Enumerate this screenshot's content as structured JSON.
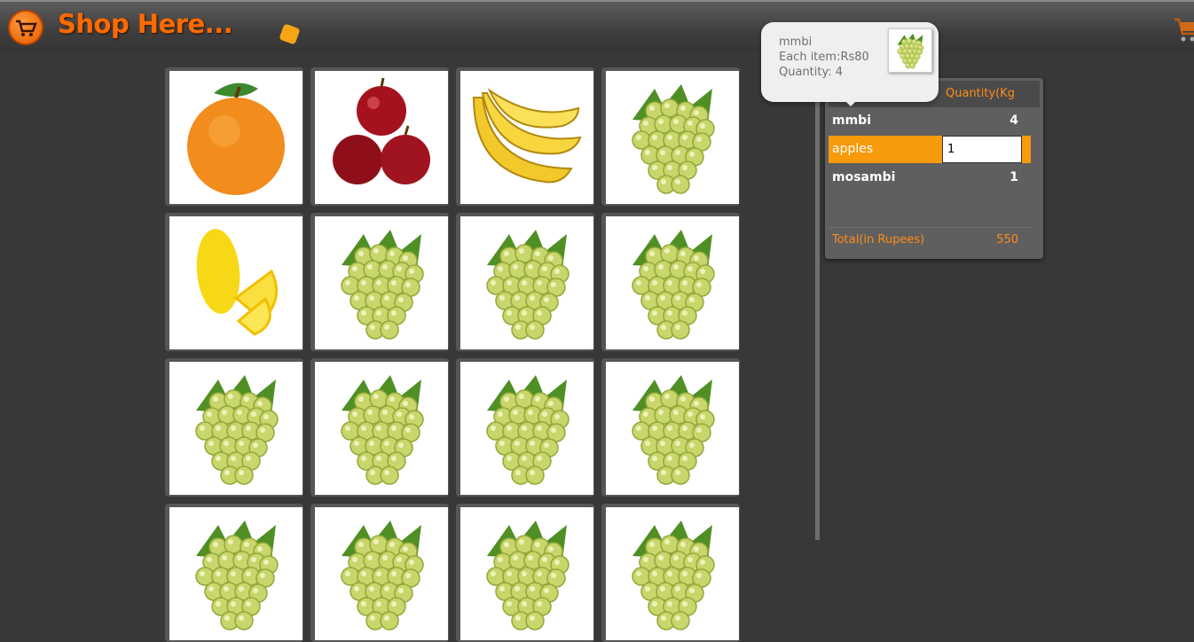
{
  "header": {
    "title": "Shop Here..."
  },
  "products": [
    {
      "name": "orange",
      "icon": "orange-icon"
    },
    {
      "name": "apples",
      "icon": "apples-icon"
    },
    {
      "name": "banana",
      "icon": "banana-icon"
    },
    {
      "name": "grapes",
      "icon": "grapes-icon"
    },
    {
      "name": "lemon",
      "icon": "lemon-icon"
    },
    {
      "name": "grapes",
      "icon": "grapes-icon"
    },
    {
      "name": "grapes",
      "icon": "grapes-icon"
    },
    {
      "name": "grapes",
      "icon": "grapes-icon"
    },
    {
      "name": "grapes",
      "icon": "grapes-icon"
    },
    {
      "name": "grapes",
      "icon": "grapes-icon"
    },
    {
      "name": "grapes",
      "icon": "grapes-icon"
    },
    {
      "name": "grapes",
      "icon": "grapes-icon"
    },
    {
      "name": "grapes",
      "icon": "grapes-icon"
    },
    {
      "name": "grapes",
      "icon": "grapes-icon"
    },
    {
      "name": "grapes",
      "icon": "grapes-icon"
    },
    {
      "name": "grapes",
      "icon": "grapes-icon"
    }
  ],
  "tooltip": {
    "name": "mmbi",
    "price_line": "Each item:Rs80",
    "quantity_line": "Quantity: 4"
  },
  "cart": {
    "quantity_header": "Quantity(Kg",
    "items": [
      {
        "name": "mmbi",
        "quantity": "4"
      },
      {
        "name": "apples",
        "quantity": "1"
      },
      {
        "name": "mosambi",
        "quantity": "1"
      }
    ],
    "total_label": "Total(in Rupees)",
    "total_value": "550"
  },
  "colors": {
    "accent": "#ff6a00",
    "selected_row": "#f79a0c",
    "background": "#383838"
  }
}
